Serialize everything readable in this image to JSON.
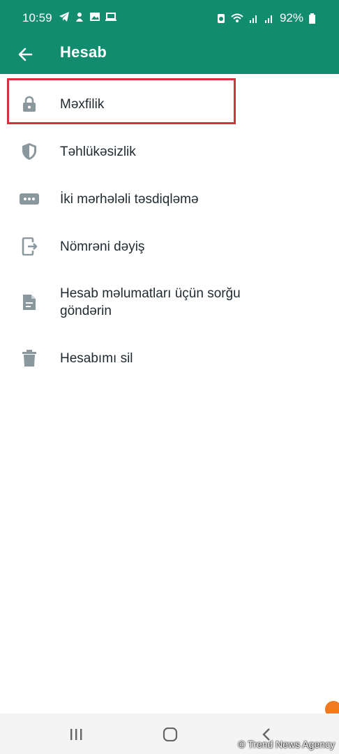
{
  "status_bar": {
    "time": "10:59",
    "battery": "92%"
  },
  "app_bar": {
    "title": "Hesab"
  },
  "menu": {
    "items": [
      {
        "label": "Məxfilik",
        "icon": "lock-icon"
      },
      {
        "label": "Təhlükəsizlik",
        "icon": "shield-icon"
      },
      {
        "label": "İki mərhələli təsdiqləmə",
        "icon": "password-dots-icon"
      },
      {
        "label": "Nömrəni dəyiş",
        "icon": "change-number-icon"
      },
      {
        "label": "Hesab məlumatları üçün sorğu göndərin",
        "icon": "document-icon"
      },
      {
        "label": "Hesabımı sil",
        "icon": "trash-icon"
      }
    ]
  },
  "watermark": "© Trend News Agency",
  "colors": {
    "primary": "#128c6f",
    "icon": "#8a979d",
    "highlight": "#d6313f"
  }
}
